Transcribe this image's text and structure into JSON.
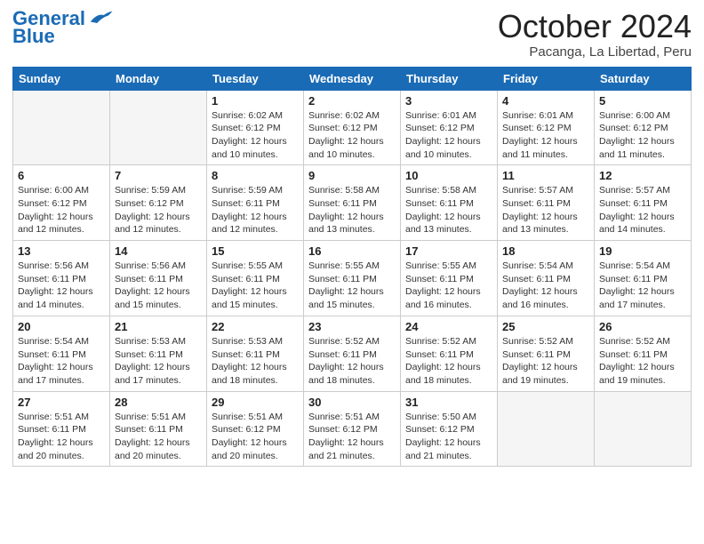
{
  "header": {
    "logo_line1": "General",
    "logo_line2": "Blue",
    "month": "October 2024",
    "location": "Pacanga, La Libertad, Peru"
  },
  "days_of_week": [
    "Sunday",
    "Monday",
    "Tuesday",
    "Wednesday",
    "Thursday",
    "Friday",
    "Saturday"
  ],
  "weeks": [
    [
      {
        "num": "",
        "sunrise": "",
        "sunset": "",
        "daylight": ""
      },
      {
        "num": "",
        "sunrise": "",
        "sunset": "",
        "daylight": ""
      },
      {
        "num": "1",
        "sunrise": "Sunrise: 6:02 AM",
        "sunset": "Sunset: 6:12 PM",
        "daylight": "Daylight: 12 hours and 10 minutes."
      },
      {
        "num": "2",
        "sunrise": "Sunrise: 6:02 AM",
        "sunset": "Sunset: 6:12 PM",
        "daylight": "Daylight: 12 hours and 10 minutes."
      },
      {
        "num": "3",
        "sunrise": "Sunrise: 6:01 AM",
        "sunset": "Sunset: 6:12 PM",
        "daylight": "Daylight: 12 hours and 10 minutes."
      },
      {
        "num": "4",
        "sunrise": "Sunrise: 6:01 AM",
        "sunset": "Sunset: 6:12 PM",
        "daylight": "Daylight: 12 hours and 11 minutes."
      },
      {
        "num": "5",
        "sunrise": "Sunrise: 6:00 AM",
        "sunset": "Sunset: 6:12 PM",
        "daylight": "Daylight: 12 hours and 11 minutes."
      }
    ],
    [
      {
        "num": "6",
        "sunrise": "Sunrise: 6:00 AM",
        "sunset": "Sunset: 6:12 PM",
        "daylight": "Daylight: 12 hours and 12 minutes."
      },
      {
        "num": "7",
        "sunrise": "Sunrise: 5:59 AM",
        "sunset": "Sunset: 6:12 PM",
        "daylight": "Daylight: 12 hours and 12 minutes."
      },
      {
        "num": "8",
        "sunrise": "Sunrise: 5:59 AM",
        "sunset": "Sunset: 6:11 PM",
        "daylight": "Daylight: 12 hours and 12 minutes."
      },
      {
        "num": "9",
        "sunrise": "Sunrise: 5:58 AM",
        "sunset": "Sunset: 6:11 PM",
        "daylight": "Daylight: 12 hours and 13 minutes."
      },
      {
        "num": "10",
        "sunrise": "Sunrise: 5:58 AM",
        "sunset": "Sunset: 6:11 PM",
        "daylight": "Daylight: 12 hours and 13 minutes."
      },
      {
        "num": "11",
        "sunrise": "Sunrise: 5:57 AM",
        "sunset": "Sunset: 6:11 PM",
        "daylight": "Daylight: 12 hours and 13 minutes."
      },
      {
        "num": "12",
        "sunrise": "Sunrise: 5:57 AM",
        "sunset": "Sunset: 6:11 PM",
        "daylight": "Daylight: 12 hours and 14 minutes."
      }
    ],
    [
      {
        "num": "13",
        "sunrise": "Sunrise: 5:56 AM",
        "sunset": "Sunset: 6:11 PM",
        "daylight": "Daylight: 12 hours and 14 minutes."
      },
      {
        "num": "14",
        "sunrise": "Sunrise: 5:56 AM",
        "sunset": "Sunset: 6:11 PM",
        "daylight": "Daylight: 12 hours and 15 minutes."
      },
      {
        "num": "15",
        "sunrise": "Sunrise: 5:55 AM",
        "sunset": "Sunset: 6:11 PM",
        "daylight": "Daylight: 12 hours and 15 minutes."
      },
      {
        "num": "16",
        "sunrise": "Sunrise: 5:55 AM",
        "sunset": "Sunset: 6:11 PM",
        "daylight": "Daylight: 12 hours and 15 minutes."
      },
      {
        "num": "17",
        "sunrise": "Sunrise: 5:55 AM",
        "sunset": "Sunset: 6:11 PM",
        "daylight": "Daylight: 12 hours and 16 minutes."
      },
      {
        "num": "18",
        "sunrise": "Sunrise: 5:54 AM",
        "sunset": "Sunset: 6:11 PM",
        "daylight": "Daylight: 12 hours and 16 minutes."
      },
      {
        "num": "19",
        "sunrise": "Sunrise: 5:54 AM",
        "sunset": "Sunset: 6:11 PM",
        "daylight": "Daylight: 12 hours and 17 minutes."
      }
    ],
    [
      {
        "num": "20",
        "sunrise": "Sunrise: 5:54 AM",
        "sunset": "Sunset: 6:11 PM",
        "daylight": "Daylight: 12 hours and 17 minutes."
      },
      {
        "num": "21",
        "sunrise": "Sunrise: 5:53 AM",
        "sunset": "Sunset: 6:11 PM",
        "daylight": "Daylight: 12 hours and 17 minutes."
      },
      {
        "num": "22",
        "sunrise": "Sunrise: 5:53 AM",
        "sunset": "Sunset: 6:11 PM",
        "daylight": "Daylight: 12 hours and 18 minutes."
      },
      {
        "num": "23",
        "sunrise": "Sunrise: 5:52 AM",
        "sunset": "Sunset: 6:11 PM",
        "daylight": "Daylight: 12 hours and 18 minutes."
      },
      {
        "num": "24",
        "sunrise": "Sunrise: 5:52 AM",
        "sunset": "Sunset: 6:11 PM",
        "daylight": "Daylight: 12 hours and 18 minutes."
      },
      {
        "num": "25",
        "sunrise": "Sunrise: 5:52 AM",
        "sunset": "Sunset: 6:11 PM",
        "daylight": "Daylight: 12 hours and 19 minutes."
      },
      {
        "num": "26",
        "sunrise": "Sunrise: 5:52 AM",
        "sunset": "Sunset: 6:11 PM",
        "daylight": "Daylight: 12 hours and 19 minutes."
      }
    ],
    [
      {
        "num": "27",
        "sunrise": "Sunrise: 5:51 AM",
        "sunset": "Sunset: 6:11 PM",
        "daylight": "Daylight: 12 hours and 20 minutes."
      },
      {
        "num": "28",
        "sunrise": "Sunrise: 5:51 AM",
        "sunset": "Sunset: 6:11 PM",
        "daylight": "Daylight: 12 hours and 20 minutes."
      },
      {
        "num": "29",
        "sunrise": "Sunrise: 5:51 AM",
        "sunset": "Sunset: 6:12 PM",
        "daylight": "Daylight: 12 hours and 20 minutes."
      },
      {
        "num": "30",
        "sunrise": "Sunrise: 5:51 AM",
        "sunset": "Sunset: 6:12 PM",
        "daylight": "Daylight: 12 hours and 21 minutes."
      },
      {
        "num": "31",
        "sunrise": "Sunrise: 5:50 AM",
        "sunset": "Sunset: 6:12 PM",
        "daylight": "Daylight: 12 hours and 21 minutes."
      },
      {
        "num": "",
        "sunrise": "",
        "sunset": "",
        "daylight": ""
      },
      {
        "num": "",
        "sunrise": "",
        "sunset": "",
        "daylight": ""
      }
    ]
  ]
}
